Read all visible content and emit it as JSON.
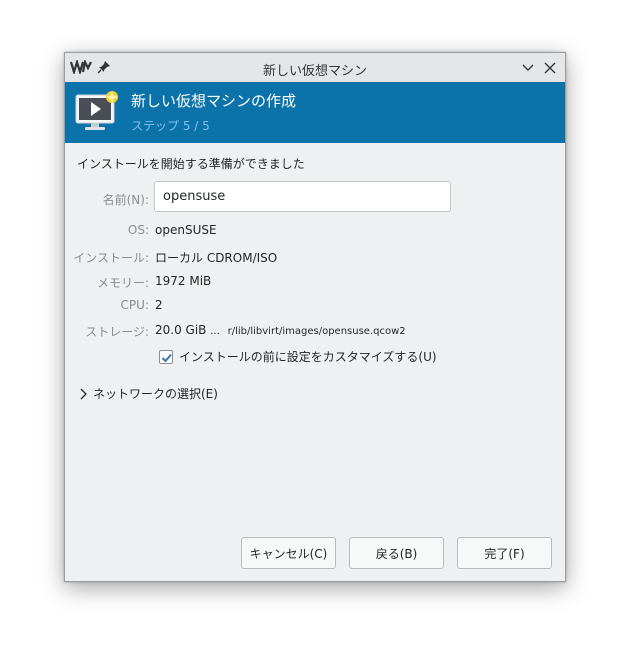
{
  "window": {
    "title": "新しい仮想マシン",
    "app_icon": "virt-manager-icon"
  },
  "header": {
    "title": "新しい仮想マシンの作成",
    "step": "ステップ 5 / 5"
  },
  "content": {
    "ready_text": "インストールを開始する準備ができました",
    "name_label": "名前(N):",
    "name_value": "opensuse",
    "os_label": "OS:",
    "os_value": "openSUSE",
    "install_label": "インストール:",
    "install_value": "ローカル CDROM/ISO",
    "memory_label": "メモリー:",
    "memory_value": "1972 MiB",
    "cpu_label": "CPU:",
    "cpu_value": "2",
    "storage_label": "ストレージ:",
    "storage_size": "20.0 GiB",
    "storage_ellipsis": "...",
    "storage_path": "r/lib/libvirt/images/opensuse.qcow2",
    "customize_label": "インストールの前に設定をカスタマイズする(U)",
    "customize_checked": true,
    "network_label": "ネットワークの選択(E)"
  },
  "buttons": {
    "cancel": "キャンセル(C)",
    "back": "戻る(B)",
    "finish": "完了(F)"
  },
  "colors": {
    "header_bg": "#0b73a9",
    "step_text": "#7fc1ea",
    "check_mark": "#3a76b0"
  }
}
